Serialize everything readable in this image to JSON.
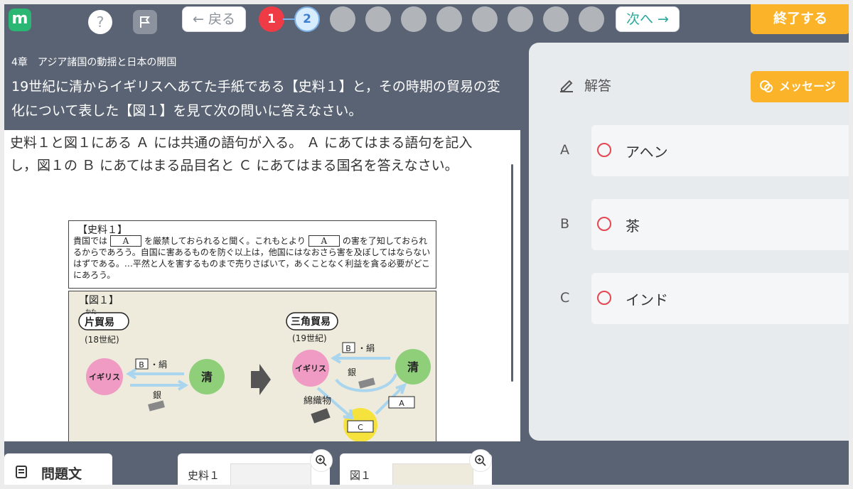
{
  "topbar": {
    "logo": "m",
    "help": "?",
    "prev_label": "← 戻る",
    "next_label": "次へ →",
    "pages": [
      "1",
      "2"
    ],
    "finish_label": "終了する",
    "colors": {
      "active": "#ee3b45",
      "current": "#3d7fd1",
      "finish": "#fbb32a"
    }
  },
  "question": {
    "chapter": "4章　アジア諸国の動揺と日本の開国",
    "title": "19世紀に清からイギリスへあてた手紙である【史料１】と，その時期の貿易の変化について表した【図１】を見て次の問いに答えなさい。",
    "text": "史料１と図１にある Ａ には共通の語句が入る。 Ａ にあてはまる語句を記入し，図１の Ｂ にあてはまる品目名と Ｃ にあてはまる国名を答えなさい。"
  },
  "source": {
    "title": "【史料１】",
    "part1": "貴国では",
    "box": "A",
    "part2": "を厳禁しておられると聞く。これもとより",
    "part3": "の害を了知しておられるからであろう。自国に害あるものを防ぐ以上は，他国にはなおさら害を及ぼしてはならないはずである。…平然と人を害するものまで売りさばいて，あくことなく利益を貪る必要がどこにあろう。"
  },
  "figure": {
    "title": "【図１】",
    "left_title": "片貿易",
    "left_ruby": "かた",
    "left_period": "(18世紀)",
    "right_title": "三角貿易",
    "right_period": "(19世紀)",
    "britain": "イギリス",
    "qing": "清",
    "silver": "銀",
    "b_box": "B",
    "silk": "・絹",
    "cotton": "綿織物",
    "a_box": "A",
    "c_box": "C"
  },
  "answer": {
    "label": "解答",
    "message_label": "メッセージ",
    "rows": [
      {
        "key": "A",
        "value": "アヘン"
      },
      {
        "key": "B",
        "value": "茶"
      },
      {
        "key": "C",
        "value": "インド"
      }
    ]
  },
  "tabs": {
    "main": "問題文",
    "thumb1": "史料１",
    "thumb2": "図１"
  }
}
